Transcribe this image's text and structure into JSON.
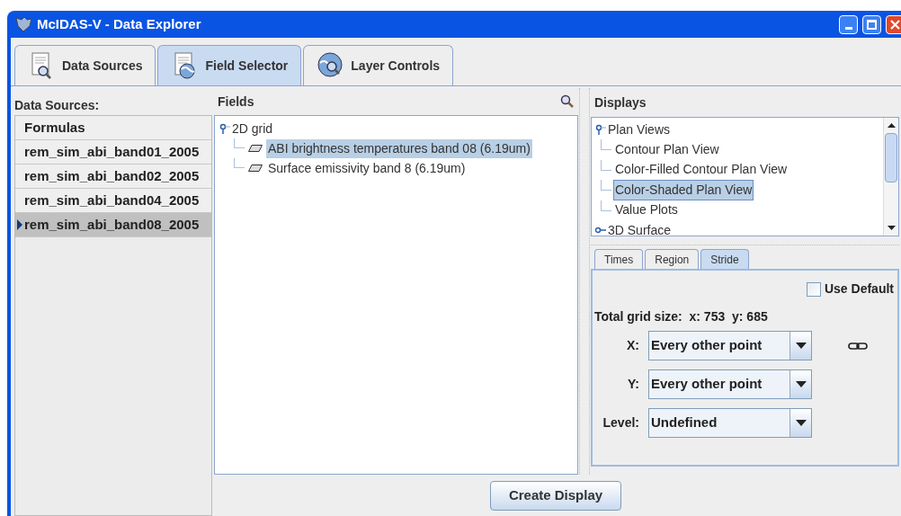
{
  "window": {
    "title": "McIDAS-V - Data Explorer"
  },
  "main_tabs": [
    {
      "label": "Data Sources",
      "selected": false
    },
    {
      "label": "Field Selector",
      "selected": true
    },
    {
      "label": "Layer Controls",
      "selected": false
    }
  ],
  "data_sources": {
    "title": "Data Sources:",
    "items": [
      {
        "label": "Formulas",
        "selected": false
      },
      {
        "label": "rem_sim_abi_band01_2005",
        "selected": false
      },
      {
        "label": "rem_sim_abi_band02_2005",
        "selected": false
      },
      {
        "label": "rem_sim_abi_band04_2005",
        "selected": false
      },
      {
        "label": "rem_sim_abi_band08_2005",
        "selected": true
      }
    ]
  },
  "fields": {
    "title": "Fields",
    "tree": [
      {
        "label": "2D grid",
        "expanded": true,
        "children": [
          {
            "label": "ABI brightness temperatures band 08 (6.19um)",
            "selected": true
          },
          {
            "label": "Surface emissivity band 8 (6.19um)",
            "selected": false
          }
        ]
      }
    ]
  },
  "displays": {
    "title": "Displays",
    "tree": [
      {
        "label": "Plan Views",
        "expanded": true,
        "children": [
          {
            "label": "Contour Plan View",
            "selected": false
          },
          {
            "label": "Color-Filled Contour Plan View",
            "selected": false
          },
          {
            "label": "Color-Shaded Plan View",
            "selected": true
          },
          {
            "label": "Value Plots",
            "selected": false
          }
        ]
      },
      {
        "label": "3D Surface",
        "expanded": false
      }
    ]
  },
  "settings_tabs": [
    {
      "label": "Times",
      "selected": false
    },
    {
      "label": "Region",
      "selected": false
    },
    {
      "label": "Stride",
      "selected": true
    }
  ],
  "stride": {
    "use_default": {
      "label": "Use Default",
      "checked": false
    },
    "grid_size": "Total grid size:  x: 753  y: 685",
    "rows": [
      {
        "label": "X:",
        "value": "Every other point",
        "linked": true
      },
      {
        "label": "Y:",
        "value": "Every other point",
        "linked": false
      },
      {
        "label": "Level:",
        "value": "Undefined",
        "linked": false
      }
    ]
  },
  "create_button": "Create Display"
}
